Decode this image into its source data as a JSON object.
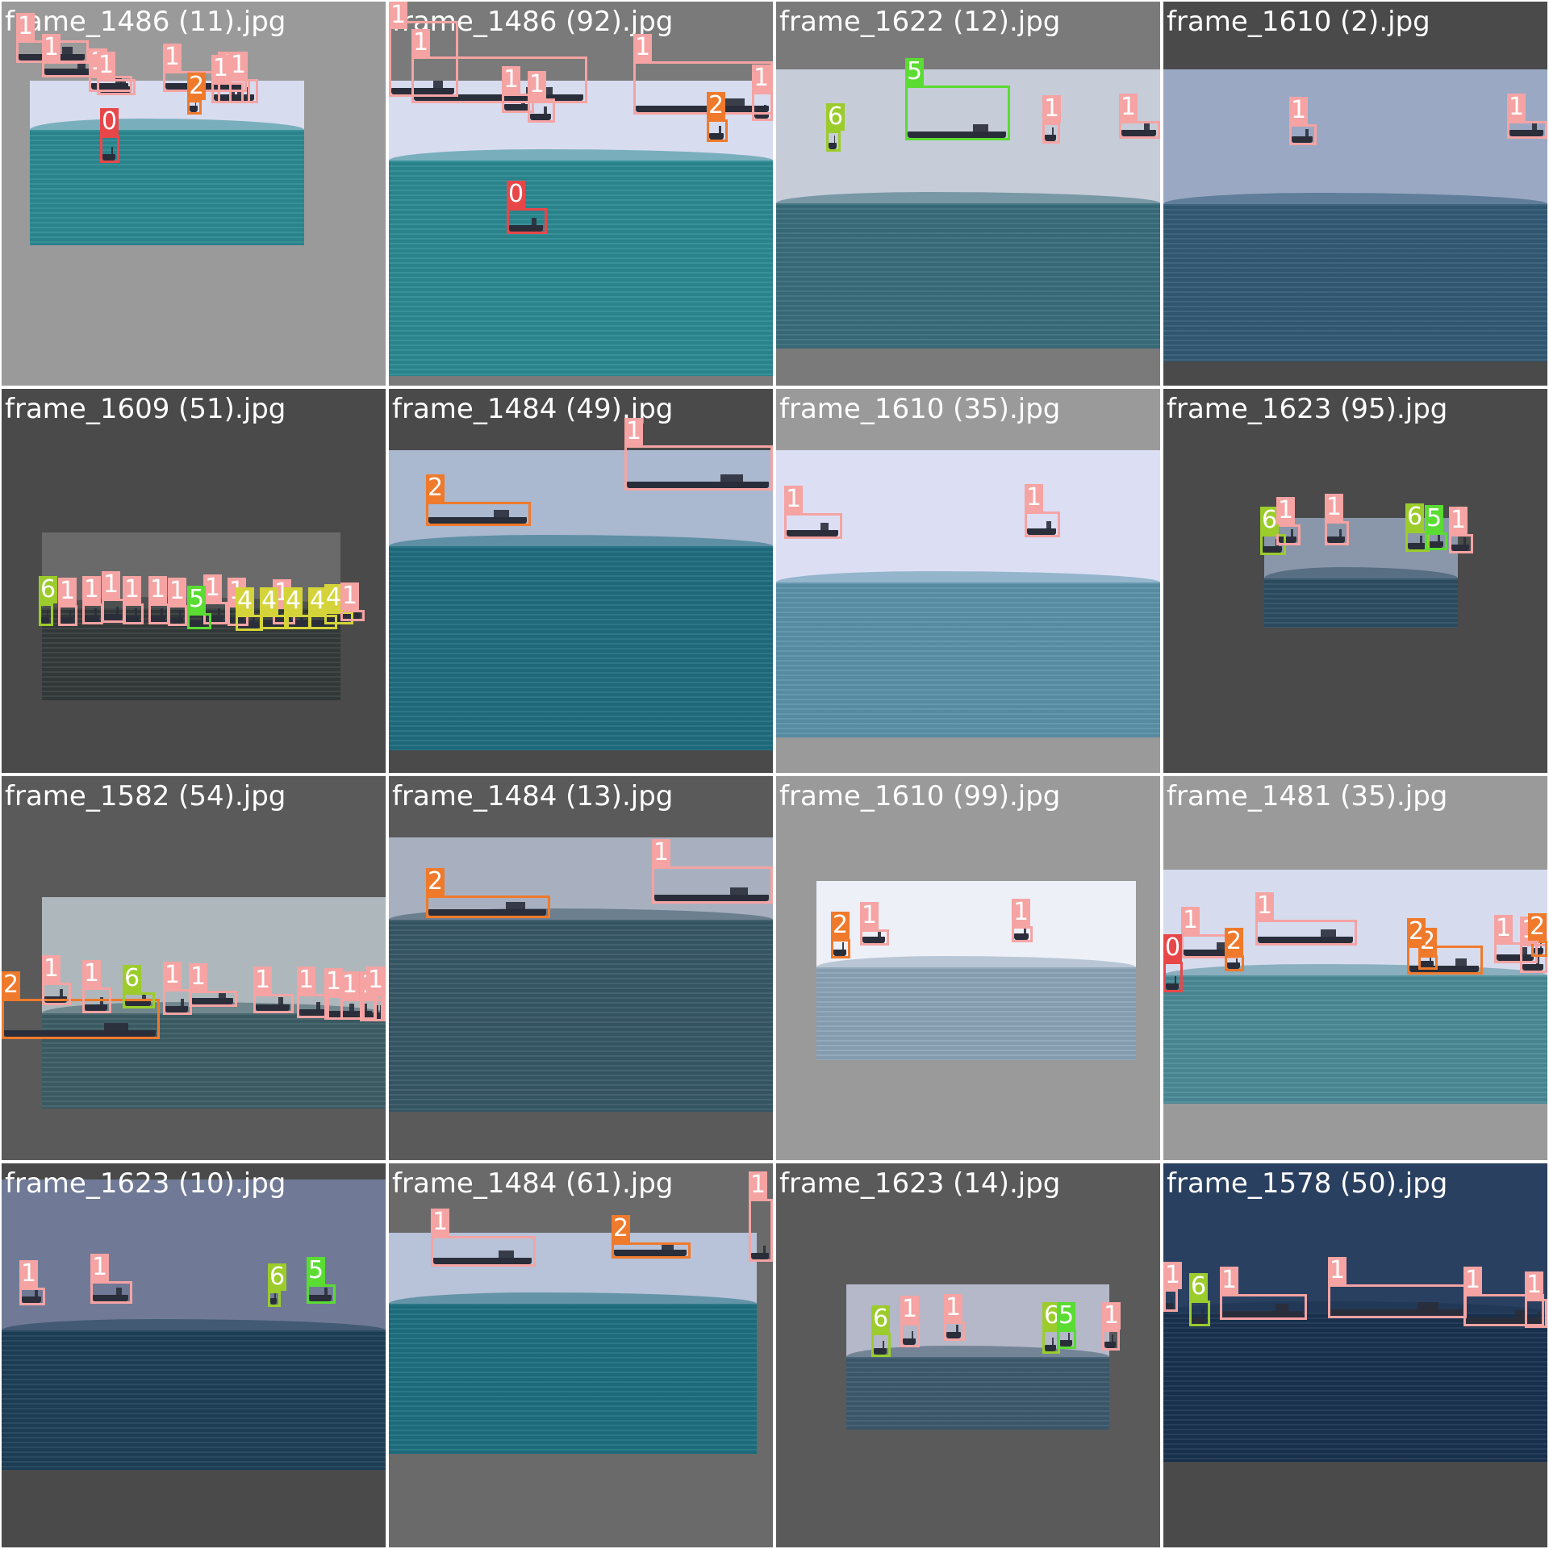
{
  "colors": {
    "0": "#e8474a",
    "1": "#f5a3a3",
    "2": "#ef7a2c",
    "4": "#d4d43a",
    "5": "#5adc32",
    "6": "#9ccc2c",
    "text": "#ffffff"
  },
  "tiles": [
    {
      "filename": "frame_1486 (11).jpg",
      "bg": "#9a9a9a",
      "sky": "#d8dcef",
      "sea": "#2c8a92",
      "horizon": 0.3,
      "boxes": [
        {
          "c": "1"
        },
        {
          "c": "1"
        },
        {
          "c": "1"
        },
        {
          "c": "1"
        },
        {
          "c": "1"
        },
        {
          "c": "1"
        },
        {
          "c": "1"
        },
        {
          "c": "1"
        },
        {
          "c": "2"
        },
        {
          "c": "0"
        }
      ]
    },
    {
      "filename": "frame_1486 (92).jpg",
      "bg": "#7a7a7a",
      "sky": "#d8dcef",
      "sea": "#2c8a92",
      "horizon": 0.27,
      "boxes": [
        {
          "c": "1"
        },
        {
          "c": "1"
        },
        {
          "c": "1"
        },
        {
          "c": "1"
        },
        {
          "c": "1"
        },
        {
          "c": "1"
        },
        {
          "c": "2"
        },
        {
          "c": "0"
        }
      ]
    },
    {
      "filename": "frame_1622 (12).jpg",
      "bg": "#7a7a7a",
      "sky": "#c6ccd8",
      "sea": "#3a6e7c",
      "horizon": 0.48,
      "boxes": [
        {
          "c": "6"
        },
        {
          "c": "5"
        },
        {
          "c": "1"
        },
        {
          "c": "1"
        }
      ]
    },
    {
      "filename": "frame_1610 (2).jpg",
      "bg": "#4a4a4a",
      "sky": "#9aa8c4",
      "sea": "#325a76",
      "horizon": 0.46,
      "boxes": [
        {
          "c": "1"
        },
        {
          "c": "1"
        }
      ]
    },
    {
      "filename": "frame_1609 (51).jpg",
      "bg": "#4a4a4a",
      "sky": "#6a6a6a",
      "sea": "#353a3a",
      "horizon": 0.45,
      "boxes": [
        {
          "c": "6"
        },
        {
          "c": "1"
        },
        {
          "c": "1"
        },
        {
          "c": "1"
        },
        {
          "c": "1"
        },
        {
          "c": "1"
        },
        {
          "c": "1"
        },
        {
          "c": "1"
        },
        {
          "c": "5"
        },
        {
          "c": "1"
        },
        {
          "c": "1"
        },
        {
          "c": "4"
        },
        {
          "c": "4"
        },
        {
          "c": "4"
        },
        {
          "c": "4"
        },
        {
          "c": "4"
        },
        {
          "c": "1"
        }
      ]
    },
    {
      "filename": "frame_1484 (49).jpg",
      "bg": "#4a4a4a",
      "sky": "#aab8d0",
      "sea": "#1f6e80",
      "horizon": 0.32,
      "boxes": [
        {
          "c": "2"
        },
        {
          "c": "1"
        }
      ]
    },
    {
      "filename": "frame_1610 (35).jpg",
      "bg": "#9a9a9a",
      "sky": "#dcdff4",
      "sea": "#5a92aa",
      "horizon": 0.46,
      "boxes": [
        {
          "c": "1"
        },
        {
          "c": "1"
        }
      ]
    },
    {
      "filename": "frame_1623 (95).jpg",
      "bg": "#4a4a4a",
      "sky": "#8a96aa",
      "sea": "#2e4e62",
      "horizon": 0.55,
      "boxes": [
        {
          "c": "6"
        },
        {
          "c": "1"
        },
        {
          "c": "1"
        },
        {
          "c": "6"
        },
        {
          "c": "5"
        },
        {
          "c": "1"
        }
      ]
    },
    {
      "filename": "frame_1582 (54).jpg",
      "bg": "#5a5a5a",
      "sky": "#aeb8bc",
      "sea": "#3e5e66",
      "horizon": 0.55,
      "boxes": [
        {
          "c": "2"
        },
        {
          "c": "1"
        },
        {
          "c": "1"
        },
        {
          "c": "6"
        },
        {
          "c": "1"
        },
        {
          "c": "1"
        },
        {
          "c": "1"
        },
        {
          "c": "1"
        },
        {
          "c": "1"
        },
        {
          "c": "1"
        },
        {
          "c": "1"
        },
        {
          "c": "1"
        },
        {
          "c": "1"
        }
      ]
    },
    {
      "filename": "frame_1484 (13).jpg",
      "bg": "#5a5a5a",
      "sky": "#a8b0c0",
      "sea": "#385866",
      "horizon": 0.3,
      "boxes": [
        {
          "c": "2"
        },
        {
          "c": "1"
        }
      ]
    },
    {
      "filename": "frame_1610 (99).jpg",
      "bg": "#9a9a9a",
      "sky": "#eef0f8",
      "sea": "#8ca4b8",
      "horizon": 0.48,
      "boxes": [
        {
          "c": "2"
        },
        {
          "c": "1"
        },
        {
          "c": "1"
        }
      ]
    },
    {
      "filename": "frame_1481 (35).jpg",
      "bg": "#9a9a9a",
      "sky": "#d6dcee",
      "sea": "#4c8a98",
      "horizon": 0.45,
      "boxes": [
        {
          "c": "0"
        },
        {
          "c": "1"
        },
        {
          "c": "2"
        },
        {
          "c": "1"
        },
        {
          "c": "2"
        },
        {
          "c": "2"
        },
        {
          "c": "1"
        },
        {
          "c": "1"
        },
        {
          "c": "2"
        }
      ]
    },
    {
      "filename": "frame_1623 (10).jpg",
      "bg": "#4a4a4a",
      "sky": "#707a96",
      "sea": "#1e4058",
      "horizon": 0.52,
      "boxes": [
        {
          "c": "1"
        },
        {
          "c": "1"
        },
        {
          "c": "6"
        },
        {
          "c": "5"
        }
      ]
    },
    {
      "filename": "frame_1484 (61).jpg",
      "bg": "#6a6a6a",
      "sky": "#b8c2d8",
      "sea": "#1e7080",
      "horizon": 0.32,
      "boxes": [
        {
          "c": "1"
        },
        {
          "c": "2"
        },
        {
          "c": "1"
        }
      ]
    },
    {
      "filename": "frame_1623 (14).jpg",
      "bg": "#5a5a5a",
      "sky": "#b4b8c8",
      "sea": "#3e5a6e",
      "horizon": 0.5,
      "boxes": [
        {
          "c": "6"
        },
        {
          "c": "1"
        },
        {
          "c": "1"
        },
        {
          "c": "6"
        },
        {
          "c": "5"
        },
        {
          "c": "1"
        }
      ]
    },
    {
      "filename": "frame_1578 (50).jpg",
      "bg": "#4a4a4a",
      "sky": "#2a4060",
      "sea": "#1a3250",
      "horizon": 0.5,
      "boxes": [
        {
          "c": "1"
        },
        {
          "c": "6"
        },
        {
          "c": "1"
        },
        {
          "c": "1"
        },
        {
          "c": "1"
        },
        {
          "c": "1"
        },
        {
          "c": "1"
        }
      ]
    }
  ]
}
